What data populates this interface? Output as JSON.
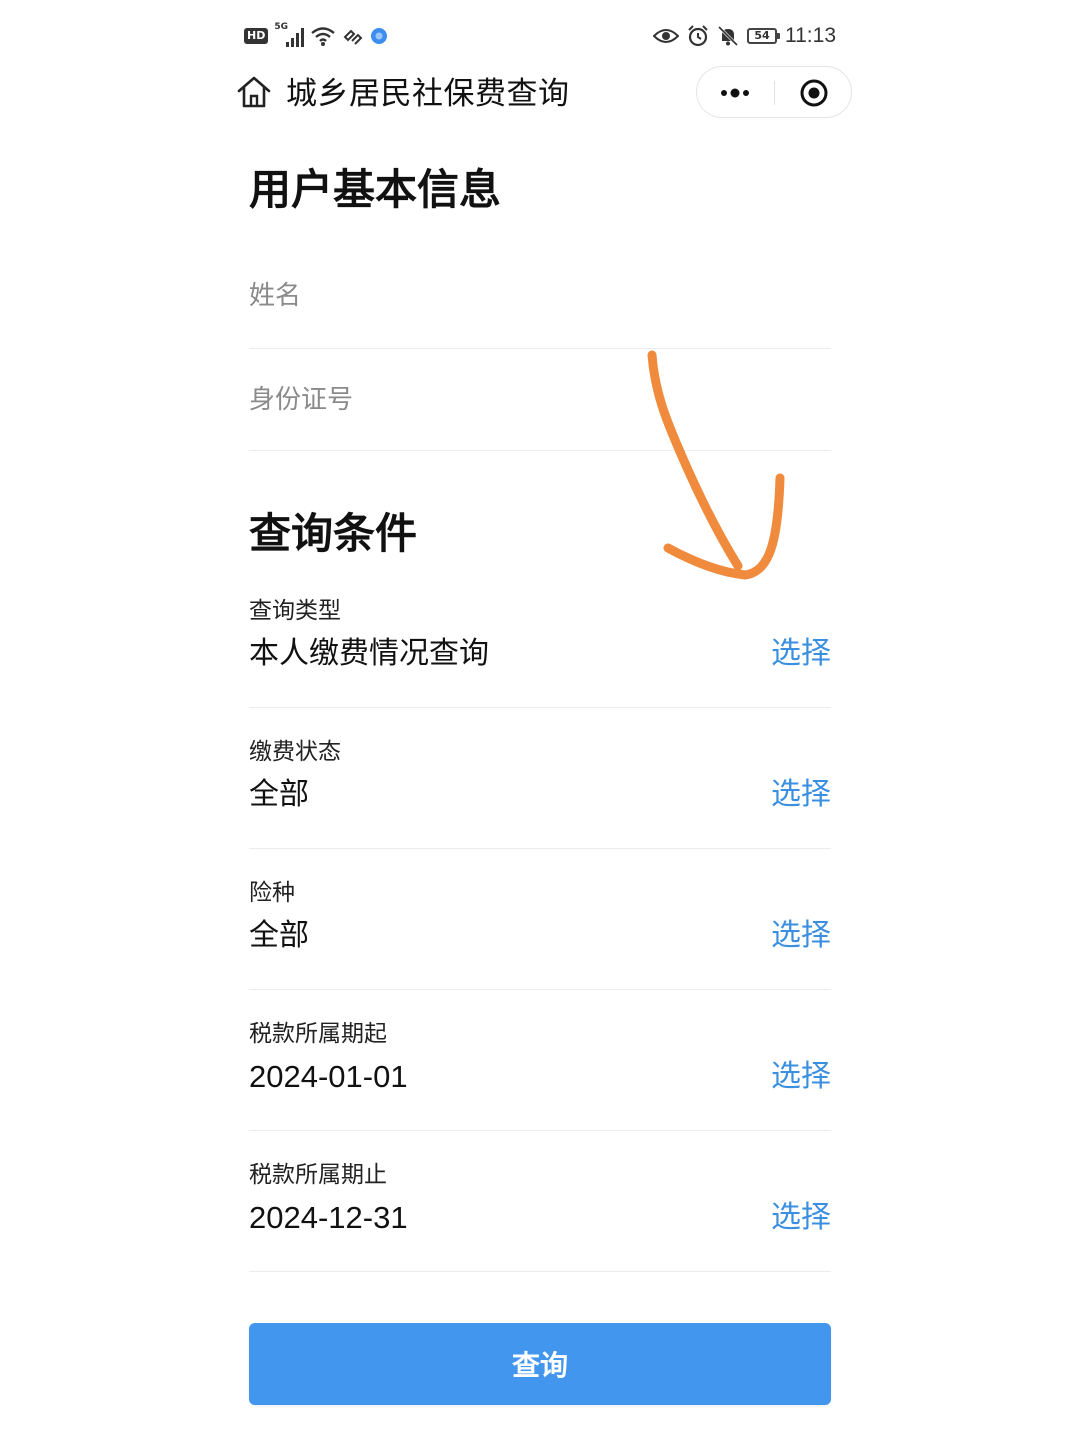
{
  "status_bar": {
    "hd_label": "HD",
    "network_label": "5G",
    "battery_level": "54",
    "time": "11:13"
  },
  "nav": {
    "title": "城乡居民社保费查询",
    "icons": [
      "home-icon",
      "more-icon",
      "close-icon"
    ]
  },
  "basic_info": {
    "title": "用户基本信息",
    "name_placeholder": "姓名",
    "id_placeholder": "身份证号"
  },
  "query_conditions": {
    "title": "查询条件",
    "select_label": "选择",
    "items": [
      {
        "label": "查询类型",
        "value": "本人缴费情况查询"
      },
      {
        "label": "缴费状态",
        "value": "全部"
      },
      {
        "label": "险种",
        "value": "全部"
      },
      {
        "label": "税款所属期起",
        "value": "2024-01-01"
      },
      {
        "label": "税款所属期止",
        "value": "2024-12-31"
      }
    ]
  },
  "submit_button": "查询",
  "colors": {
    "accent_link": "#3b8fe0",
    "button_bg": "#4396ee",
    "annotation": "#f08a3c"
  }
}
